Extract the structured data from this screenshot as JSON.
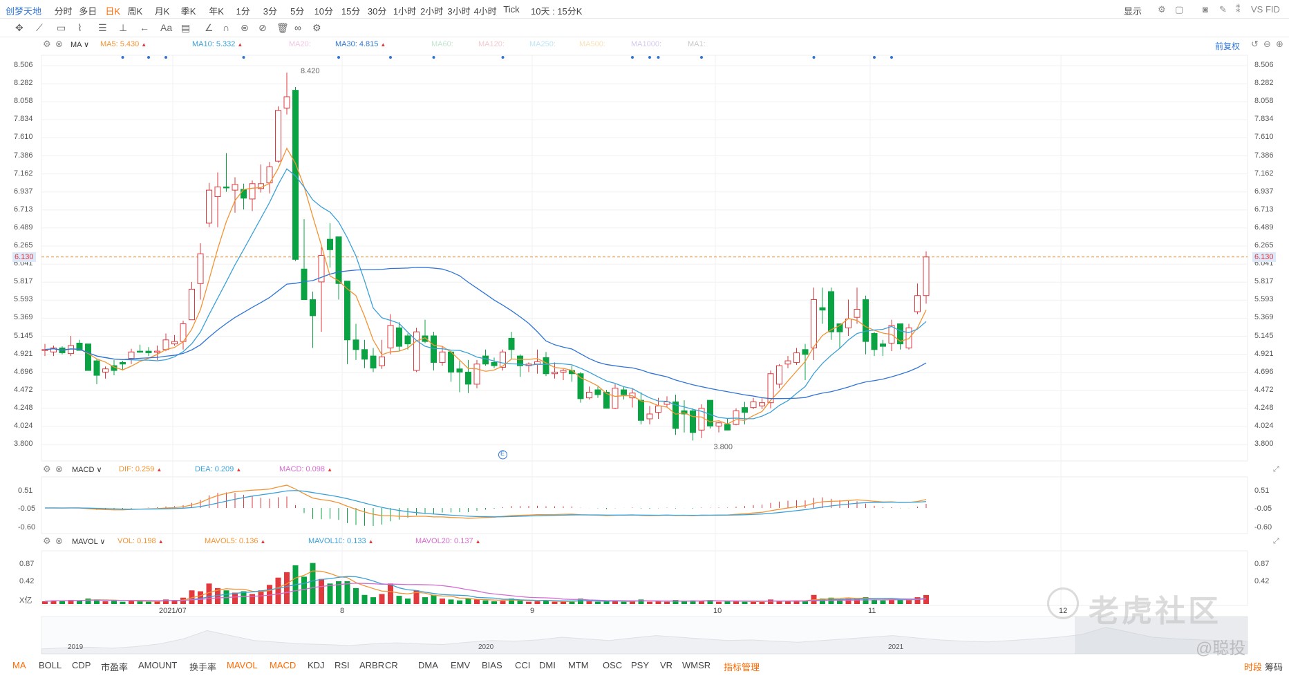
{
  "topbar": {
    "symbol": "创梦天地",
    "tabs": [
      "分时",
      "多日",
      "日K",
      "周K",
      "月K",
      "季K",
      "年K",
      "1分",
      "3分",
      "5分",
      "10分",
      "15分",
      "30分",
      "1小时",
      "2小时",
      "3小时",
      "4小时",
      "Tick"
    ],
    "active_tab": "日K",
    "range_select": "10天 : 15分K",
    "right": [
      "显示",
      "VS FID"
    ]
  },
  "main": {
    "indicator": "MA",
    "legend": [
      {
        "label": "MA5: 5.430",
        "color": "#f39232",
        "arrow": "▲"
      },
      {
        "label": "MA10: 5.332",
        "color": "#3aa0d8",
        "arrow": "▲"
      },
      {
        "label": "MA20:",
        "color": "#f1c6e6",
        "arrow": ""
      },
      {
        "label": "MA30: 4.815",
        "color": "#2f74d6",
        "arrow": "▲"
      },
      {
        "label": "MA60:",
        "color": "#c3e6d0",
        "arrow": ""
      },
      {
        "label": "MA120:",
        "color": "#f5c9cf",
        "arrow": ""
      },
      {
        "label": "MA250:",
        "color": "#bfe6f5",
        "arrow": ""
      },
      {
        "label": "MA500:",
        "color": "#f9e2b8",
        "arrow": ""
      },
      {
        "label": "MA1000:",
        "color": "#d6c8ef",
        "arrow": ""
      },
      {
        "label": "MA1:",
        "color": "#c8c8c8",
        "arrow": ""
      }
    ],
    "adjust": "前复权",
    "price_ticks": [
      "8.506",
      "8.282",
      "8.058",
      "7.834",
      "7.610",
      "7.386",
      "7.162",
      "6.937",
      "6.713",
      "6.489",
      "6.265",
      "6.041",
      "5.817",
      "5.593",
      "5.369",
      "5.145",
      "4.921",
      "4.696",
      "4.472",
      "4.248",
      "4.024",
      "3.800"
    ],
    "current_price": "6.130",
    "high_label": "8.420",
    "low_label": "3.800",
    "event_marker": "E"
  },
  "macd": {
    "name": "MACD",
    "dif": "DIF: 0.259",
    "dea": "DEA: 0.209",
    "macd": "MACD: 0.098",
    "ticks": [
      "0.51",
      "-0.05",
      "-0.60"
    ]
  },
  "mavol": {
    "name": "MAVOL",
    "vol": "VOL: 0.198",
    "m5": "MAVOL5: 0.136",
    "m10": "MAVOL10: 0.133",
    "m20": "MAVOL20: 0.137",
    "ticks": [
      "0.87",
      "0.42",
      "X亿"
    ]
  },
  "xaxis": [
    "2021/07",
    "8",
    "9",
    "10",
    "11",
    "12"
  ],
  "navigator": {
    "labels": [
      "2019",
      "2020",
      "2021"
    ],
    "series": [
      0.15,
      0.18,
      0.2,
      0.17,
      0.22,
      0.3,
      0.45,
      0.7,
      0.55,
      0.4,
      0.35,
      0.3,
      0.28,
      0.25,
      0.3,
      0.33,
      0.3,
      0.28,
      0.35,
      0.4,
      0.38,
      0.42,
      0.5,
      0.45,
      0.4,
      0.48,
      0.55,
      0.5,
      0.45,
      0.4,
      0.42,
      0.38,
      0.35,
      0.4,
      0.45,
      0.5,
      0.55,
      0.48,
      0.42,
      0.38,
      0.36,
      0.4,
      0.45,
      0.5,
      0.58,
      0.8,
      0.65,
      0.5,
      0.45,
      0.42,
      0.4,
      0.38
    ]
  },
  "bottom_tabs": [
    "MA",
    "BOLL",
    "CDP",
    "市盈率",
    "AMOUNT",
    "换手率",
    "MAVOL",
    "MACD",
    "KDJ",
    "RSI",
    "ARBR",
    "CR",
    "DMA",
    "EMV",
    "BIAS",
    "CCI",
    "DMI",
    "MTM",
    "OSC",
    "PSY",
    "VR",
    "WMSR",
    "指标管理"
  ],
  "bottom_active": [
    "MA",
    "MAVOL",
    "MACD",
    "指标管理"
  ],
  "bottom_right": [
    "时段",
    "筹码"
  ],
  "watermark": {
    "text": "老虎社区",
    "handle": "@聪投"
  },
  "colors": {
    "up": "#e0393e",
    "down": "#0aa344",
    "ma5": "#f39232",
    "ma10": "#3aa0d8",
    "ma30": "#2f74d6",
    "dif": "#f39232",
    "dea": "#3aa0d8",
    "mavol20": "#d46bd1",
    "accent": "#ff6a00",
    "link": "#2f74d6"
  },
  "chart_data": {
    "type": "candlestick",
    "ohlc": [
      [
        4.98,
        5.05,
        4.9,
        4.98
      ],
      [
        4.95,
        5.03,
        4.9,
        5.0
      ],
      [
        5.0,
        5.02,
        4.92,
        4.94
      ],
      [
        4.93,
        5.15,
        4.9,
        5.03
      ],
      [
        5.06,
        5.1,
        4.98,
        4.97
      ],
      [
        5.05,
        5.05,
        4.72,
        4.72
      ],
      [
        4.84,
        4.86,
        4.55,
        4.66
      ],
      [
        4.7,
        4.77,
        4.62,
        4.74
      ],
      [
        4.78,
        4.85,
        4.66,
        4.72
      ],
      [
        4.82,
        4.84,
        4.72,
        4.8
      ],
      [
        4.87,
        4.99,
        4.8,
        4.95
      ],
      [
        4.96,
        5.04,
        4.94,
        4.95
      ],
      [
        4.96,
        5.01,
        4.9,
        4.94
      ],
      [
        4.95,
        5.03,
        4.85,
        4.96
      ],
      [
        4.98,
        5.18,
        4.96,
        5.1
      ],
      [
        5.05,
        5.16,
        5.03,
        5.08
      ],
      [
        5.08,
        5.34,
        4.98,
        5.3
      ],
      [
        5.35,
        5.82,
        5.35,
        5.73
      ],
      [
        5.8,
        6.3,
        5.6,
        6.17
      ],
      [
        6.55,
        7.05,
        6.5,
        6.96
      ],
      [
        6.88,
        7.18,
        6.5,
        7.0
      ],
      [
        7.0,
        7.42,
        6.94,
        6.99
      ],
      [
        6.96,
        7.12,
        6.68,
        7.03
      ],
      [
        6.97,
        7.04,
        6.72,
        6.86
      ],
      [
        6.85,
        7.08,
        6.7,
        7.04
      ],
      [
        6.98,
        7.28,
        6.93,
        7.04
      ],
      [
        7.05,
        7.31,
        6.92,
        7.25
      ],
      [
        7.32,
        8.0,
        7.3,
        7.95
      ],
      [
        7.98,
        8.42,
        7.9,
        8.12
      ],
      [
        8.2,
        8.24,
        6.08,
        6.1
      ],
      [
        5.98,
        6.6,
        5.6,
        5.6
      ],
      [
        5.6,
        5.7,
        5.0,
        5.4
      ],
      [
        5.82,
        6.25,
        5.2,
        6.15
      ],
      [
        6.35,
        6.55,
        6.0,
        6.22
      ],
      [
        6.38,
        6.38,
        5.6,
        5.8
      ],
      [
        5.83,
        5.83,
        4.8,
        5.1
      ],
      [
        5.1,
        5.3,
        4.85,
        4.98
      ],
      [
        4.98,
        5.1,
        4.75,
        4.86
      ],
      [
        4.9,
        5.0,
        4.7,
        4.75
      ],
      [
        4.78,
        5.1,
        4.74,
        4.89
      ],
      [
        5.0,
        5.42,
        4.92,
        5.28
      ],
      [
        5.25,
        5.32,
        4.96,
        5.02
      ],
      [
        5.15,
        5.18,
        4.98,
        5.05
      ],
      [
        4.72,
        5.25,
        4.7,
        5.2
      ],
      [
        5.15,
        5.35,
        5.06,
        5.08
      ],
      [
        5.15,
        5.2,
        4.72,
        4.82
      ],
      [
        4.82,
        5.02,
        4.78,
        4.95
      ],
      [
        4.95,
        4.97,
        4.58,
        4.7
      ],
      [
        4.74,
        4.84,
        4.45,
        4.7
      ],
      [
        4.7,
        4.85,
        4.44,
        4.55
      ],
      [
        4.55,
        4.85,
        4.5,
        4.8
      ],
      [
        4.9,
        4.98,
        4.78,
        4.8
      ],
      [
        4.82,
        4.88,
        4.75,
        4.78
      ],
      [
        4.76,
        4.98,
        4.72,
        4.95
      ],
      [
        5.12,
        5.2,
        4.86,
        4.98
      ],
      [
        4.9,
        4.92,
        4.64,
        4.78
      ],
      [
        4.78,
        4.82,
        4.7,
        4.8
      ],
      [
        4.8,
        4.98,
        4.68,
        4.83
      ],
      [
        4.88,
        4.95,
        4.65,
        4.68
      ],
      [
        4.68,
        4.82,
        4.62,
        4.7
      ],
      [
        4.7,
        4.74,
        4.6,
        4.72
      ],
      [
        4.72,
        4.78,
        4.58,
        4.68
      ],
      [
        4.68,
        4.7,
        4.32,
        4.37
      ],
      [
        4.38,
        4.52,
        4.36,
        4.45
      ],
      [
        4.48,
        4.52,
        4.38,
        4.42
      ],
      [
        4.45,
        4.48,
        4.25,
        4.25
      ],
      [
        4.25,
        4.55,
        4.24,
        4.5
      ],
      [
        4.48,
        4.52,
        4.36,
        4.42
      ],
      [
        4.38,
        4.5,
        4.26,
        4.44
      ],
      [
        4.35,
        4.45,
        4.05,
        4.1
      ],
      [
        4.12,
        4.28,
        4.05,
        4.18
      ],
      [
        4.2,
        4.38,
        4.12,
        4.28
      ],
      [
        4.3,
        4.4,
        4.26,
        4.33
      ],
      [
        4.33,
        4.42,
        3.92,
        4.0
      ],
      [
        4.22,
        4.35,
        3.95,
        4.18
      ],
      [
        4.22,
        4.25,
        3.85,
        3.95
      ],
      [
        3.98,
        4.3,
        3.88,
        4.25
      ],
      [
        4.35,
        4.35,
        4.0,
        4.03
      ],
      [
        4.03,
        4.08,
        3.95,
        4.07
      ],
      [
        4.05,
        4.12,
        3.98,
        3.98
      ],
      [
        4.05,
        4.25,
        4.04,
        4.22
      ],
      [
        4.26,
        4.33,
        4.05,
        4.2
      ],
      [
        4.26,
        4.38,
        4.24,
        4.33
      ],
      [
        4.28,
        4.38,
        4.24,
        4.32
      ],
      [
        4.32,
        4.72,
        4.25,
        4.68
      ],
      [
        4.55,
        4.8,
        4.5,
        4.78
      ],
      [
        4.8,
        4.9,
        4.75,
        4.84
      ],
      [
        4.82,
        5.0,
        4.79,
        4.94
      ],
      [
        4.98,
        5.05,
        4.6,
        4.92
      ],
      [
        5.0,
        5.75,
        4.85,
        5.6
      ],
      [
        5.5,
        5.75,
        5.3,
        5.47
      ],
      [
        5.7,
        5.75,
        5.1,
        5.2
      ],
      [
        5.3,
        5.3,
        5.0,
        5.2
      ],
      [
        5.25,
        5.6,
        5.15,
        5.36
      ],
      [
        5.38,
        5.75,
        5.3,
        5.48
      ],
      [
        5.6,
        5.65,
        4.92,
        5.08
      ],
      [
        5.18,
        5.2,
        4.9,
        4.98
      ],
      [
        5.05,
        5.1,
        4.9,
        5.02
      ],
      [
        5.06,
        5.35,
        4.96,
        5.28
      ],
      [
        5.3,
        5.3,
        4.98,
        5.05
      ],
      [
        5.0,
        5.3,
        4.98,
        5.25
      ],
      [
        5.45,
        5.8,
        5.42,
        5.65
      ],
      [
        5.65,
        6.2,
        5.55,
        6.13
      ]
    ],
    "volume": [
      0.06,
      0.08,
      0.07,
      0.09,
      0.08,
      0.12,
      0.1,
      0.06,
      0.07,
      0.05,
      0.08,
      0.06,
      0.05,
      0.06,
      0.1,
      0.09,
      0.14,
      0.3,
      0.28,
      0.45,
      0.35,
      0.3,
      0.25,
      0.28,
      0.22,
      0.3,
      0.42,
      0.58,
      0.7,
      0.85,
      0.6,
      0.9,
      0.55,
      0.45,
      0.5,
      0.5,
      0.35,
      0.2,
      0.15,
      0.22,
      0.45,
      0.18,
      0.12,
      0.3,
      0.15,
      0.2,
      0.12,
      0.1,
      0.08,
      0.12,
      0.1,
      0.08,
      0.06,
      0.07,
      0.12,
      0.08,
      0.05,
      0.06,
      0.07,
      0.05,
      0.06,
      0.05,
      0.12,
      0.06,
      0.05,
      0.06,
      0.08,
      0.05,
      0.06,
      0.1,
      0.05,
      0.06,
      0.05,
      0.09,
      0.06,
      0.08,
      0.07,
      0.09,
      0.05,
      0.06,
      0.06,
      0.05,
      0.06,
      0.05,
      0.1,
      0.07,
      0.06,
      0.08,
      0.06,
      0.2,
      0.12,
      0.14,
      0.1,
      0.12,
      0.13,
      0.15,
      0.1,
      0.08,
      0.09,
      0.1,
      0.09,
      0.15,
      0.198
    ],
    "price_range": [
      3.8,
      8.506
    ],
    "event_dots": [
      9,
      12,
      14,
      23,
      34,
      40,
      45,
      53,
      68,
      70,
      71,
      76,
      89,
      96,
      98
    ],
    "earnings_marker_index": 53,
    "high_index": 28,
    "low_index": 75,
    "macd_range": [
      -0.6,
      0.51
    ],
    "volume_range": [
      0,
      0.87
    ]
  }
}
